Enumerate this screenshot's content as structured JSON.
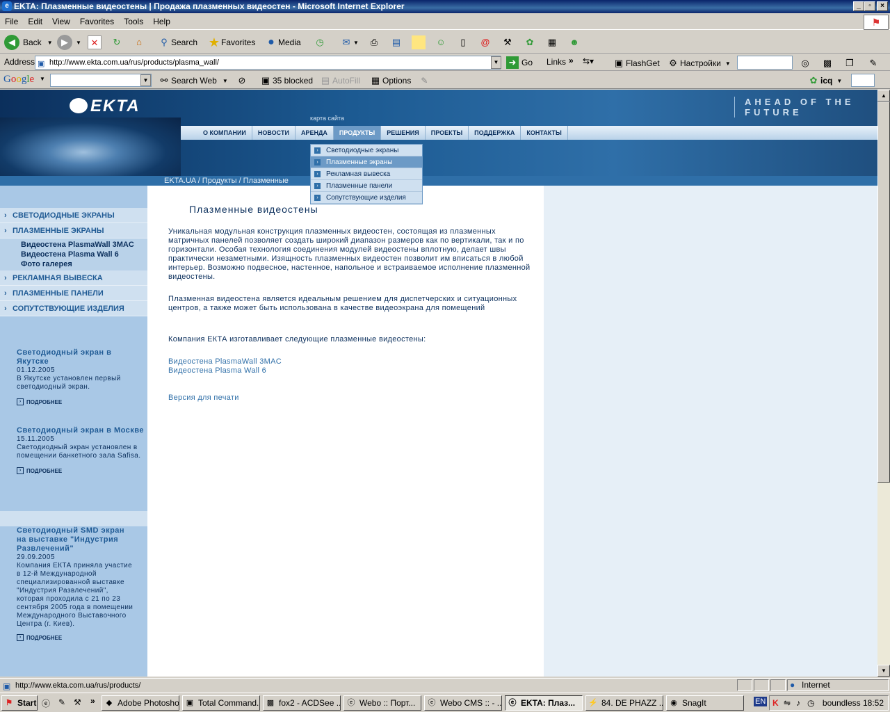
{
  "window": {
    "title": "EKTA: Плазменные видеостены | Продажа плазменных видеостен - Microsoft Internet Explorer"
  },
  "menubar": [
    "File",
    "Edit",
    "View",
    "Favorites",
    "Tools",
    "Help"
  ],
  "toolbar": {
    "back": "Back",
    "search": "Search",
    "favorites": "Favorites",
    "media": "Media"
  },
  "address": {
    "label": "Address",
    "url": "http://www.ekta.com.ua/rus/products/plasma_wall/",
    "go": "Go",
    "links": "Links",
    "flashget": "FlashGet",
    "settings": "Настройки"
  },
  "google": {
    "brand": "Google",
    "search_web": "Search Web",
    "blocked": "35 blocked",
    "autofill": "AutoFill",
    "options": "Options",
    "icq": "icq"
  },
  "site": {
    "logo": "EKTA",
    "tagline": "AHEAD OF THE FUTURE",
    "sitemap": "карта сайта",
    "nav": [
      "О КОМПАНИИ",
      "НОВОСТИ",
      "АРЕНДА",
      "ПРОДУКТЫ",
      "РЕШЕНИЯ",
      "ПРОЕКТЫ",
      "ПОДДЕРЖКА",
      "КОНТАКТЫ"
    ],
    "breadcrumb": "EKTA.UA / Продукты / Плазменные",
    "dropdown": [
      "Светодиодные экраны",
      "Плазменные экраны",
      "Рекламная вывеска",
      "Плазменные панели",
      "Сопутствующие изделия"
    ],
    "sidebar": {
      "menu1": "СВЕТОДИОДНЫЕ ЭКРАНЫ",
      "menu2": "ПЛАЗМЕННЫЕ ЭКРАНЫ",
      "sub": [
        "Видеостена PlasmaWall 3MAC",
        "Видеостена Plasma Wall 6",
        "Фото галерея"
      ],
      "menu3": "РЕКЛАМНАЯ ВЫВЕСКА",
      "menu4": "ПЛАЗМЕННЫЕ ПАНЕЛИ",
      "menu5": "СОПУТСТВУЮЩИЕ ИЗДЕЛИЯ"
    },
    "news": [
      {
        "title": "Светодиодный экран в Якутске",
        "date": "01.12.2005",
        "text": "В Якутске установлен первый светодиодный экран.",
        "more": "ПОДРОБНЕЕ"
      },
      {
        "title": "Светодиодный экран в Москве",
        "date": "15.11.2005",
        "text": "Светодиодный экран установлен в помещении банкетного зала Safisa.",
        "more": "ПОДРОБНЕЕ"
      },
      {
        "title": "Светодиодный SMD экран на выставке \"Индустрия Развлечений\"",
        "date": "29.09.2005",
        "text": "Компания ЕКТА приняла участие в 12-й Международной специализированной выставке \"Индустрия Развлечений\", которая проходила с 21 по 23 сентября 2005 года в помещении Международного Выставочного Центра (г. Киев).",
        "more": "ПОДРОБНЕЕ"
      }
    ],
    "content": {
      "heading": "Плазменные видеостены",
      "p1": "Уникальная модульная конструкция плазменных видеостен, состоящая из плазменных матричных панелей позволяет создать широкий диапазон размеров как по вертикали, так и по горизонтали. Особая технология соединения модулей видеостены вплотную, делает швы практически незаметными. Изящность плазменных видеостен позволит им вписаться в любой интерьер. Возможно подвесное, настенное, напольное и встраиваемое исполнение плазменной видеостены.",
      "p2": "Плазменная видеостена является идеальным решением для диспетчерских и ситуационных центров, а также может быть использована в качестве видеоэкрана для помещений",
      "p3": "Компания ЕКТА изготавливает следующие плазменные видеостены:",
      "link1": "Видеостена PlasmaWall 3MAC",
      "link2": "Видеостена Plasma Wall 6",
      "print": "Версия для печати"
    }
  },
  "status": {
    "url": "http://www.ekta.com.ua/rus/products/",
    "zone": "Internet"
  },
  "taskbar": {
    "start": "Start",
    "items": [
      "Adobe Photoshop",
      "Total Command...",
      "fox2 - ACDSee ...",
      "Webo :: Порт...",
      "Webo CMS :: - ...",
      "EKTA: Плаз...",
      "84. DE PHAZZ ...",
      "SnagIt"
    ],
    "lang": "EN",
    "clock": "boundless 18:52"
  }
}
